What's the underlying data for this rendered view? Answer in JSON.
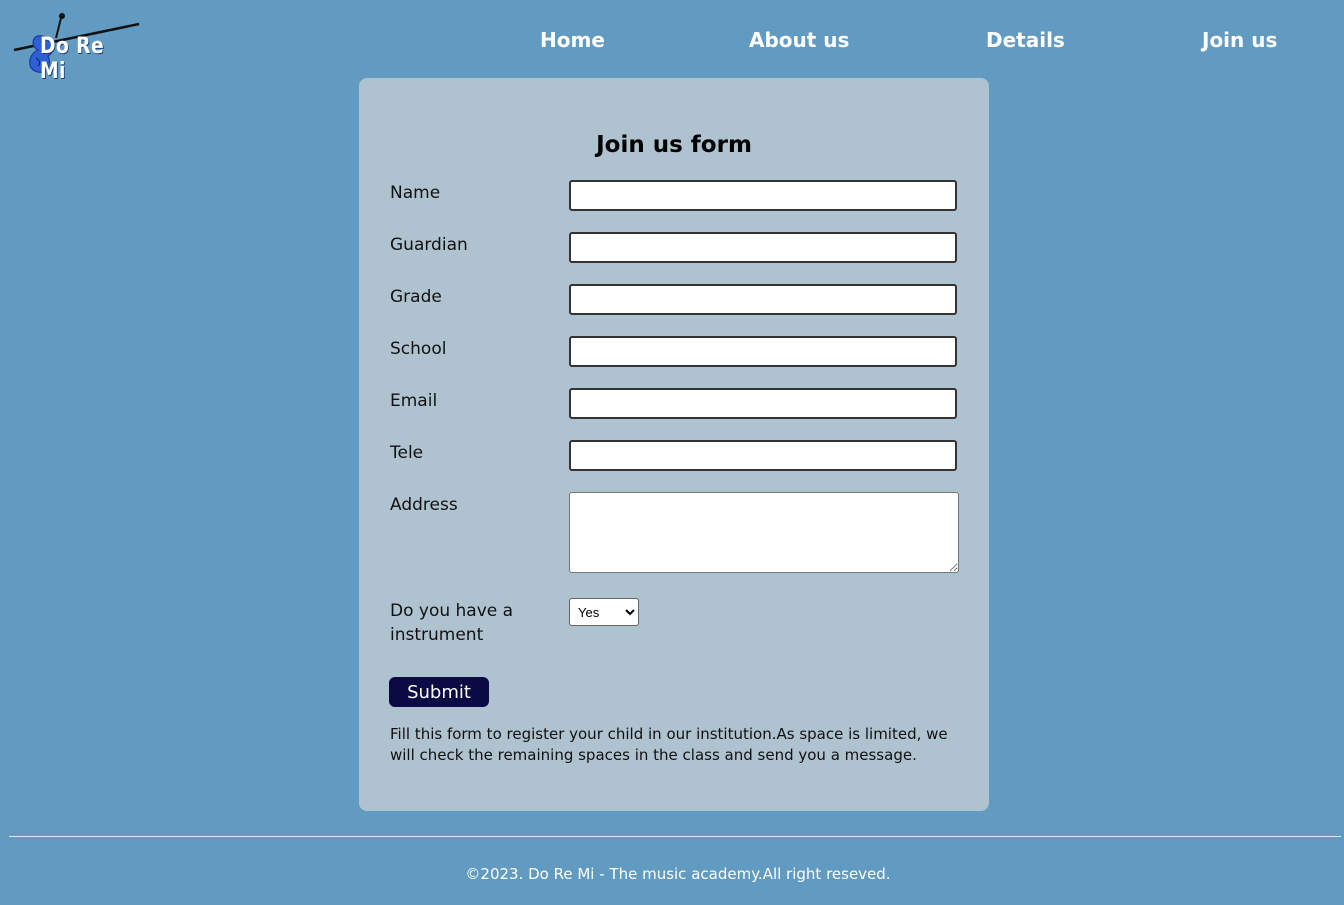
{
  "logo": {
    "text": "Do Re Mi",
    "icon": "violin-icon"
  },
  "nav": {
    "items": [
      {
        "label": "Home"
      },
      {
        "label": "About us"
      },
      {
        "label": "Details"
      },
      {
        "label": "Join us"
      }
    ]
  },
  "form": {
    "title": "Join us form",
    "fields": [
      {
        "label": "Name",
        "value": ""
      },
      {
        "label": "Guardian",
        "value": ""
      },
      {
        "label": "Grade",
        "value": ""
      },
      {
        "label": "School",
        "value": ""
      },
      {
        "label": "Email",
        "value": ""
      },
      {
        "label": "Tele",
        "value": ""
      },
      {
        "label": "Address",
        "value": ""
      }
    ],
    "instrument": {
      "label": "Do you have a instrument",
      "selected": "Yes",
      "options": [
        "Yes"
      ]
    },
    "submit_label": "Submit",
    "note": "Fill this form to register your child in our institution.As space is limited, we will check the remaining spaces in the class and send you a message."
  },
  "footer": {
    "text": "©2023. Do Re Mi - The music academy.All right reseved."
  },
  "colors": {
    "background": "#629bc1",
    "card": "#afc2cf",
    "submit": "#0a0a45"
  }
}
